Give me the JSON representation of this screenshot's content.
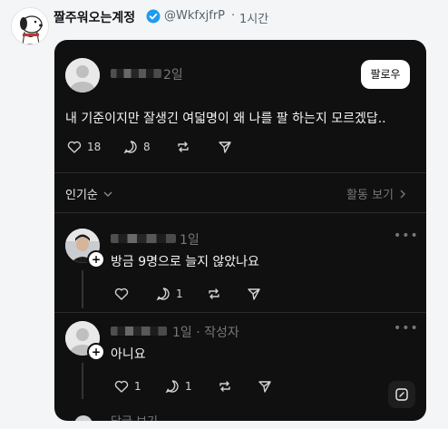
{
  "header": {
    "account_name": "짤주워오는계정",
    "handle": "@WkfxjfrP",
    "separator": "·",
    "time_ago": "1시간",
    "verified_icon": "verified-badge-icon",
    "verified_color": "#1d9bf0"
  },
  "post": {
    "time_ago": "2일",
    "follow_label": "팔로우",
    "text": "내 기준이지만 잘생긴 여덟명이 왜 나를 팔 하는지 모르겠답..",
    "likes": "18",
    "replies": "8",
    "icons": [
      "heart-icon",
      "comment-icon",
      "repost-icon",
      "share-icon"
    ]
  },
  "replies_bar": {
    "sort_label": "인기순",
    "activity_label": "활동 보기"
  },
  "replies": [
    {
      "time_ago": "1일",
      "text": "방금 9명으로 늘지 않았나요",
      "comments": "1",
      "more_icon": "more-dots-icon"
    },
    {
      "time_ago": "1일 · 작성자",
      "text": "아니요",
      "likes": "1",
      "comments": "1",
      "more_icon": "more-dots-icon"
    }
  ],
  "peek": {
    "text": "답글 보기"
  },
  "colors": {
    "card_bg": "#101010",
    "page_bg": "#f4f5f6",
    "text_primary": "#f3f5f7",
    "text_muted": "#777777"
  }
}
